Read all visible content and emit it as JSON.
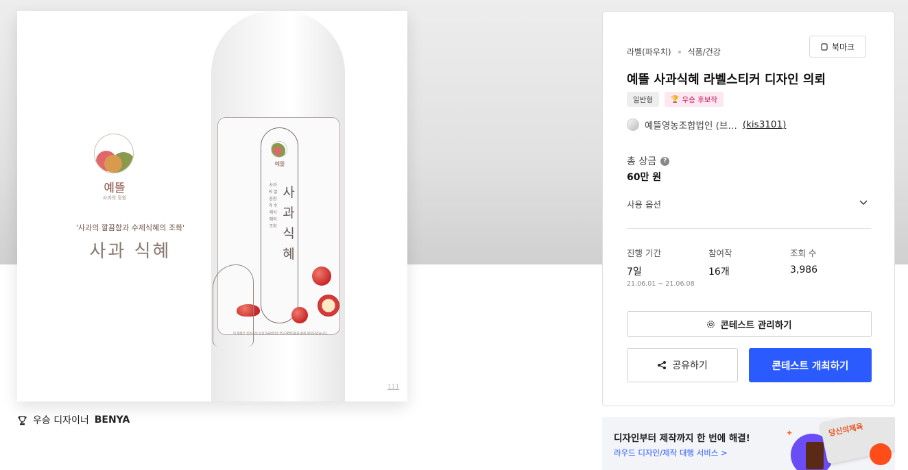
{
  "hero": {
    "brand_name": "예뜰",
    "brand_sub": "사과의 정원",
    "tagline": "'사과의 깔끔함과 수제식혜의 조화'",
    "product_name": "사과 식혜",
    "label_vertical": "사과식혜",
    "label_vertical_sub": "사과의 깔끔함과 수제식혜의 조화",
    "label_brand": "예뜰",
    "label_content": "사과즙 (유미인) 13%",
    "bottom_line": "이 제품은 충주시의 농업기술센터의 연구개발지원을 통해 제작되었습니다.",
    "watermark": "111"
  },
  "winner": {
    "label": "우승 디자이너",
    "name": "BENYA"
  },
  "card": {
    "category": "라벨(파우치)",
    "subcategory": "식품/건강",
    "bookmark": "북마크",
    "title": "예뜰 사과식혜 라벨스티커 디자인 의뢰",
    "badge_type": "일반형",
    "badge_winner": "우승 후보작",
    "owner_name": "예뜰영농조합법인 (브…",
    "owner_id": "(kis3101)",
    "prize_label": "총 상금",
    "prize_value": "60만 원",
    "usage_label": "사용 옵션",
    "stats": {
      "period_label": "진행 기간",
      "period_value": "7일",
      "period_dates": "21.06.01 ~ 21.06.08",
      "entries_label": "참여작",
      "entries_value": "16개",
      "views_label": "조회 수",
      "views_value": "3,986"
    },
    "manage_button": "콘테스트 관리하기",
    "share_button": "공유하기",
    "host_button": "콘테스트 개최하기"
  },
  "banner": {
    "title": "디자인부터 제작까지 한 번에 해결!",
    "link": "라우드 디자인/제작 대행 서비스 >",
    "stamp": "당신의제육"
  },
  "colors": {
    "primary": "#2b5bff",
    "badge_pink_bg": "#fde8f1",
    "badge_pink_text": "#c2185b"
  }
}
